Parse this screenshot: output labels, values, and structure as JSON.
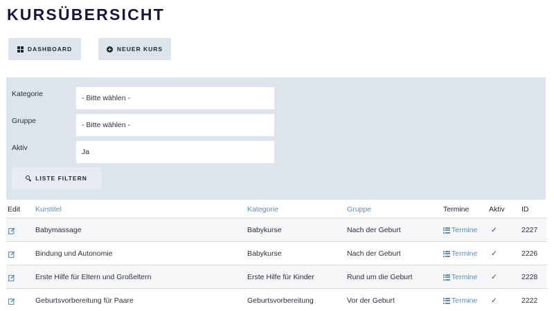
{
  "page": {
    "title": "KURSÜBERSICHT"
  },
  "actions": {
    "dashboard_label": "DASHBOARD",
    "new_course_label": "NEUER KURS"
  },
  "filters": {
    "category": {
      "label": "Kategorie",
      "value": "- Bitte wählen -"
    },
    "group": {
      "label": "Gruppe",
      "value": "- Bitte wählen -"
    },
    "active": {
      "label": "Aktiv",
      "value": "Ja"
    },
    "submit_label": "LISTE FILTERN"
  },
  "table": {
    "headers": {
      "edit": "Edit",
      "title": "Kurstitel",
      "category": "Kategorie",
      "group": "Gruppe",
      "dates": "Termine",
      "active": "Aktiv",
      "id": "ID"
    },
    "rows": [
      {
        "title": "Babymassage",
        "category": "Babykurse",
        "group": "Nach der Geburt",
        "dates": "Termine",
        "active": "✓",
        "id": "2227"
      },
      {
        "title": "Bindung und Autonomie",
        "category": "Babykurse",
        "group": "Nach der Geburt",
        "dates": "Termine",
        "active": "✓",
        "id": "2226"
      },
      {
        "title": "Erste Hilfe für Eltern und Großeltern",
        "category": "Erste Hilfe für Kinder",
        "group": "Rund um die Geburt",
        "dates": "Termine",
        "active": "✓",
        "id": "2228"
      },
      {
        "title": "Geburtsvorbereitung für Paare",
        "category": "Geburtsvorbereitung",
        "group": "Vor der Geburt",
        "dates": "Termine",
        "active": "✓",
        "id": "2222"
      }
    ]
  },
  "icons": {
    "dashboard": "grid-icon",
    "new_course": "plus-circle-icon",
    "filter": "search-icon",
    "edit": "edit-icon",
    "dates": "list-icon"
  },
  "colors": {
    "title": "#14163a",
    "panel": "#dde4ec",
    "link": "#5f8cb0",
    "row_alt": "#f4f6f8"
  }
}
